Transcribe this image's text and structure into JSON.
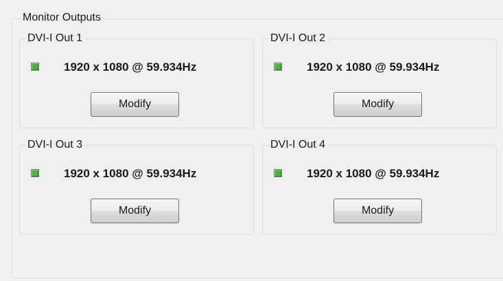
{
  "panel": {
    "title": "Monitor Outputs",
    "status_color": "#4cb43a",
    "outputs": [
      {
        "label": "DVI-I Out 1",
        "status": "1920 x 1080 @ 59.934Hz",
        "button": "Modify"
      },
      {
        "label": "DVI-I Out 2",
        "status": "1920 x 1080 @ 59.934Hz",
        "button": "Modify"
      },
      {
        "label": "DVI-I Out 3",
        "status": "1920 x 1080 @ 59.934Hz",
        "button": "Modify"
      },
      {
        "label": "DVI-I Out 4",
        "status": "1920 x 1080 @ 59.934Hz",
        "button": "Modify"
      }
    ]
  }
}
